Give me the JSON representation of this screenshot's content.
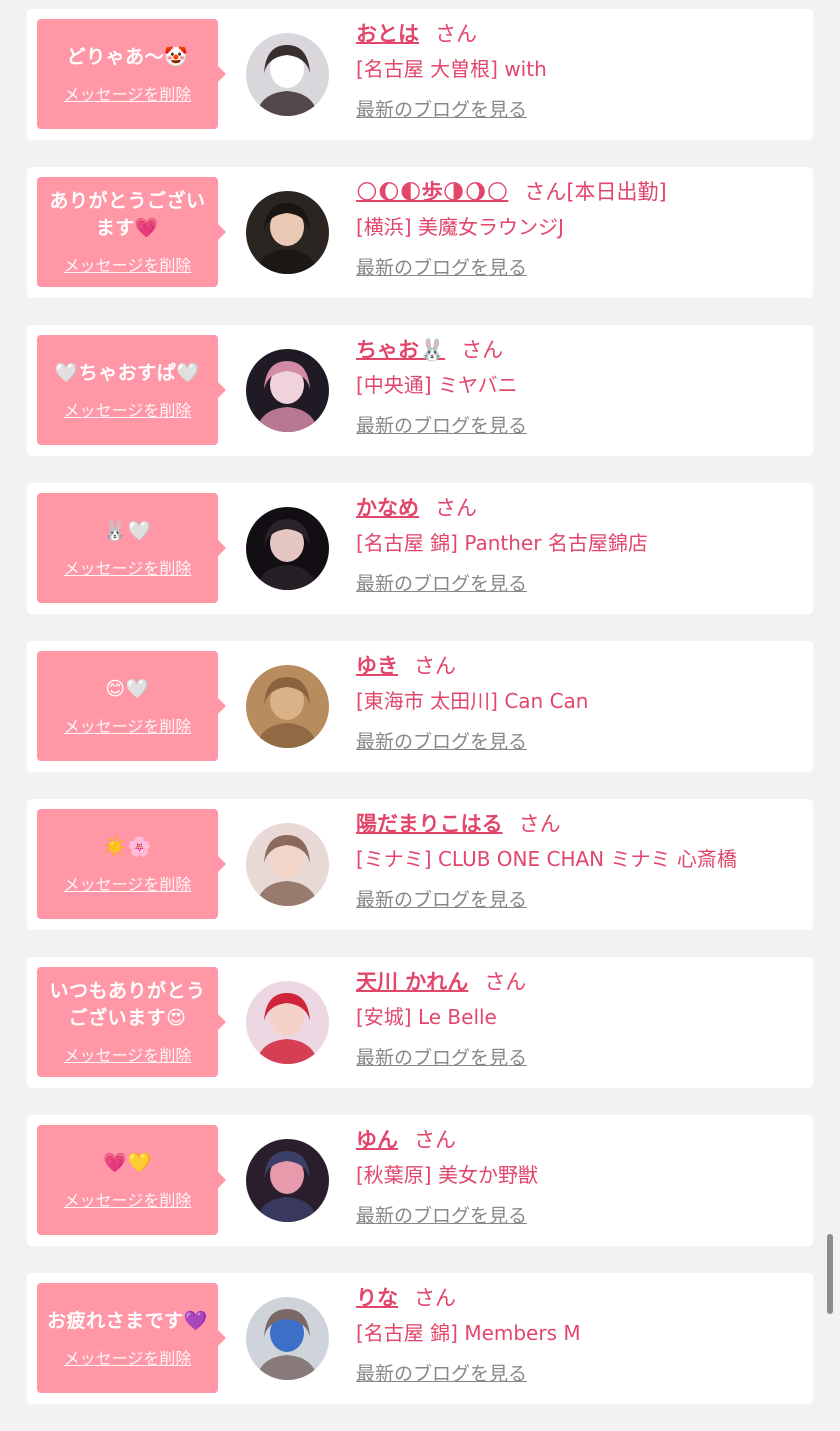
{
  "honorific": "さん",
  "delete_label": "メッセージを削除",
  "blog_label": "最新のブログを見る",
  "colors": {
    "accent": "#e2466b",
    "bubble": "#ff97a6",
    "link_gray": "#888888",
    "background": "#f2f2f2"
  },
  "messages": [
    {
      "bubble_text": "どりゃあ〜🤡",
      "name": "おとは",
      "name_suffix": "",
      "shop": "[名古屋 大曽根] with",
      "avatar_icon": "avatar-photo-icon"
    },
    {
      "bubble_text": "ありがとうございます💗",
      "name": "🌕🌔🌓歩🌗🌖🌕",
      "name_suffix": "[本日出勤]",
      "shop": "[横浜] 美魔女ラウンジJ",
      "avatar_icon": "avatar-photo-icon"
    },
    {
      "bubble_text": "🤍ちゃおすぱ🤍",
      "name": "ちゃお🐰",
      "name_suffix": "",
      "shop": "[中央通] ミヤバニ",
      "avatar_icon": "avatar-photo-icon"
    },
    {
      "bubble_text": "🐰🤍",
      "name": "かなめ",
      "name_suffix": "",
      "shop": "[名古屋 錦] Panther 名古屋錦店",
      "avatar_icon": "avatar-photo-icon"
    },
    {
      "bubble_text": "😊🤍",
      "name": "ゆき",
      "name_suffix": "",
      "shop": "[東海市 太田川] Can Can",
      "avatar_icon": "avatar-photo-icon"
    },
    {
      "bubble_text": "☀️🌸",
      "name": "陽だまりこはる",
      "name_suffix": "",
      "shop": "[ミナミ] CLUB ONE CHAN ミナミ 心斎橋",
      "avatar_icon": "avatar-photo-icon"
    },
    {
      "bubble_text": "いつもありがとうございます😍",
      "name": "天川 かれん",
      "name_suffix": "",
      "shop": "[安城] Le Belle",
      "avatar_icon": "avatar-photo-icon"
    },
    {
      "bubble_text": "💗💛",
      "name": "ゆん",
      "name_suffix": "",
      "shop": "[秋葉原] 美女か野獣",
      "avatar_icon": "avatar-photo-icon"
    },
    {
      "bubble_text": "お疲れさまです💜",
      "name": "りな",
      "name_suffix": "",
      "shop": "[名古屋 錦] Members M",
      "avatar_icon": "avatar-photo-icon"
    }
  ]
}
